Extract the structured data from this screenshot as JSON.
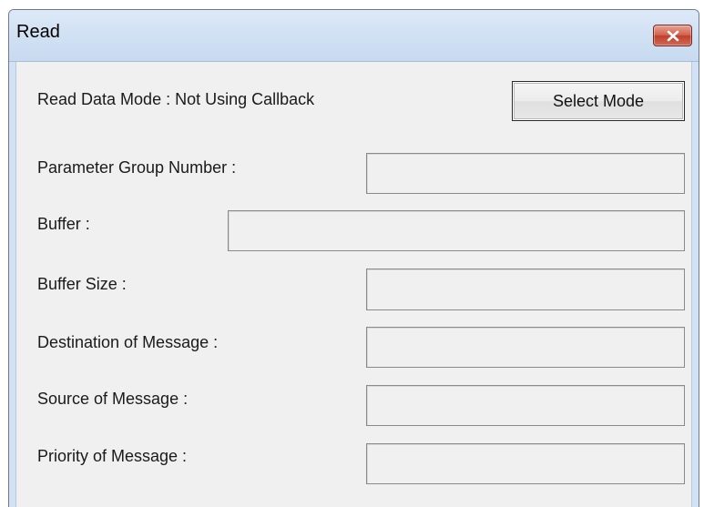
{
  "window": {
    "title": "Read"
  },
  "mode": {
    "label": "Read Data Mode : Not Using Callback",
    "button_label": "Select Mode"
  },
  "fields": {
    "pgn": {
      "label": "Parameter Group Number :",
      "value": ""
    },
    "buffer": {
      "label": "Buffer :",
      "value": ""
    },
    "buffer_size": {
      "label": "Buffer Size :",
      "value": ""
    },
    "destination": {
      "label": "Destination of Message :",
      "value": ""
    },
    "source": {
      "label": "Source of Message :",
      "value": ""
    },
    "priority": {
      "label": "Priority of Message :",
      "value": ""
    }
  },
  "icons": {
    "close": "close-icon"
  },
  "colors": {
    "close_button": "#c7432d",
    "titlebar": "#d2e2f4",
    "client_area": "#f0f0f0"
  }
}
